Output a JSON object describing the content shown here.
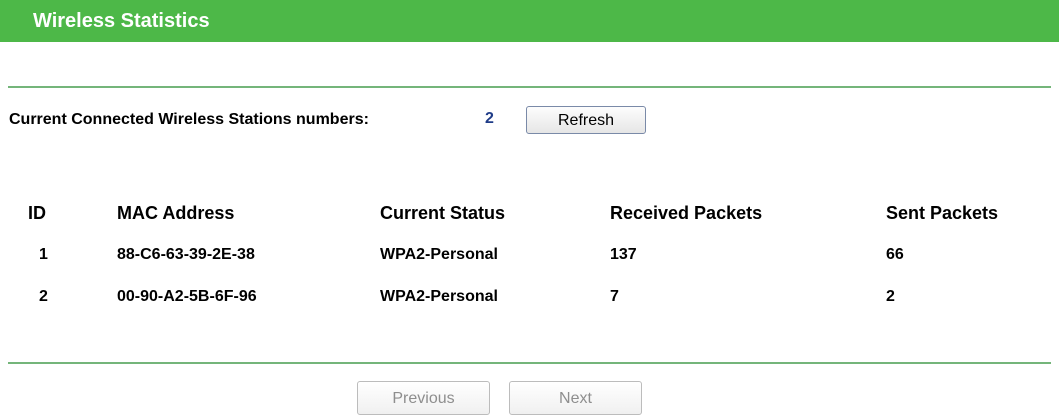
{
  "page": {
    "title": "Wireless Statistics"
  },
  "summary": {
    "label": "Current Connected Wireless Stations numbers:",
    "count": "2",
    "refresh_label": "Refresh"
  },
  "table": {
    "headers": {
      "id": "ID",
      "mac": "MAC Address",
      "status": "Current Status",
      "received": "Received Packets",
      "sent": "Sent Packets"
    },
    "rows": [
      {
        "id": "1",
        "mac": "88-C6-63-39-2E-38",
        "status": "WPA2-Personal",
        "received": "137",
        "sent": "66"
      },
      {
        "id": "2",
        "mac": "00-90-A2-5B-6F-96",
        "status": "WPA2-Personal",
        "received": "7",
        "sent": "2"
      }
    ]
  },
  "pagination": {
    "previous_label": "Previous",
    "next_label": "Next",
    "previous_enabled": false,
    "next_enabled": false
  },
  "colors": {
    "title_bar": "#4db848",
    "divider": "#74b57a",
    "count_value": "#1f3c88"
  }
}
